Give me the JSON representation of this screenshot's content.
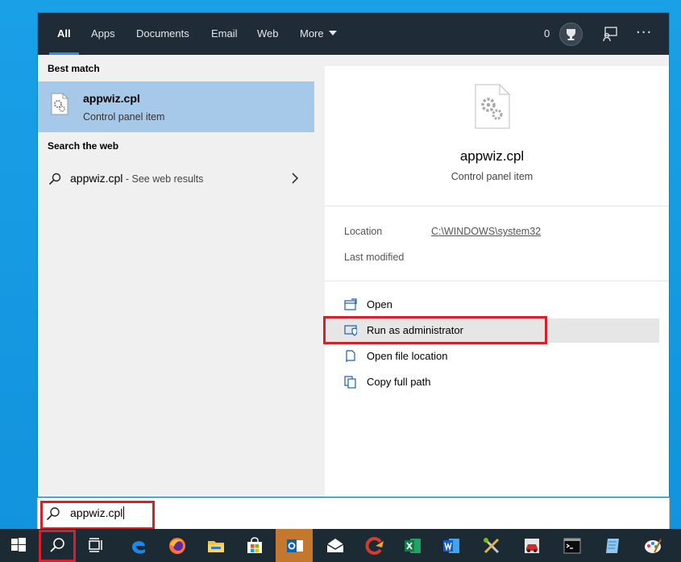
{
  "tabs": [
    {
      "label": "All",
      "active": true
    },
    {
      "label": "Apps",
      "active": false
    },
    {
      "label": "Documents",
      "active": false
    },
    {
      "label": "Web",
      "active": false
    },
    {
      "label": "Email",
      "active": false
    },
    {
      "label": "More",
      "active": false
    }
  ],
  "header": {
    "rewards_count": "0",
    "icons": [
      "trophy-icon",
      "feedback-icon",
      "more-options-icon"
    ]
  },
  "left": {
    "best_match_heading": "Best match",
    "best_match": {
      "title": "appwiz.cpl",
      "subtitle": "Control panel item"
    },
    "search_web_heading": "Search the web",
    "web_result": {
      "query": "appwiz.cpl",
      "suffix": " - See web results"
    }
  },
  "preview": {
    "title": "appwiz.cpl",
    "subtitle": "Control panel item",
    "location_label": "Location",
    "location_value": "C:\\WINDOWS\\system32",
    "last_modified_label": "Last modified",
    "actions": [
      {
        "label": "Open",
        "icon": "open-window-icon"
      },
      {
        "label": "Run as administrator",
        "icon": "shield-icon",
        "highlighted": true
      },
      {
        "label": "Open file location",
        "icon": "file-location-icon"
      },
      {
        "label": "Copy full path",
        "icon": "copy-icon"
      }
    ]
  },
  "search": {
    "value": "appwiz.cpl"
  },
  "taskbar": {
    "items": [
      "windows-start-icon",
      "search-icon",
      "task-view-icon",
      "edge-icon",
      "firefox-icon",
      "file-explorer-icon",
      "store-icon",
      "outlook-icon",
      "mail-icon",
      "ccleaner-icon",
      "excel-icon",
      "word-icon",
      "settings-tool-icon",
      "car-app-icon",
      "terminal-icon",
      "notepad-icon",
      "paint-icon"
    ]
  },
  "colors": {
    "accent": "#2d8cf0",
    "highlight_box": "#d6202a",
    "best_match_bg": "#a6c8e9",
    "topbar": "#1f2b36",
    "taskbar": "#1c2a34"
  }
}
